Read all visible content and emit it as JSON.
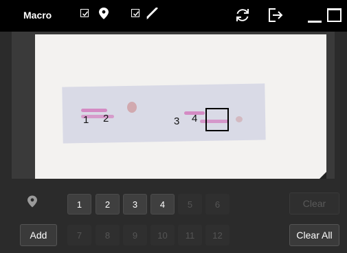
{
  "window": {
    "title": "Macro"
  },
  "toolbar": {
    "show_markers_checked": true,
    "show_annotations_checked": true,
    "icons": [
      "checkbox",
      "location-pin-icon",
      "checkbox",
      "pen-icon",
      "refresh-icon",
      "export-icon",
      "minimize-icon",
      "maximize-icon"
    ]
  },
  "slide_labels": [
    "1",
    "2",
    "3",
    "4"
  ],
  "positions": {
    "row1": [
      {
        "label": "1",
        "active": true
      },
      {
        "label": "2",
        "active": true
      },
      {
        "label": "3",
        "active": true
      },
      {
        "label": "4",
        "active": true
      },
      {
        "label": "5",
        "active": false
      },
      {
        "label": "6",
        "active": false
      }
    ],
    "row2": [
      {
        "label": "7",
        "active": false
      },
      {
        "label": "8",
        "active": false
      },
      {
        "label": "9",
        "active": false
      },
      {
        "label": "10",
        "active": false
      },
      {
        "label": "11",
        "active": false
      },
      {
        "label": "12",
        "active": false
      }
    ]
  },
  "actions": {
    "add_label": "Add",
    "clear_label": "Clear",
    "clear_all_label": "Clear All"
  },
  "colors": {
    "titlebar": "#000000",
    "background": "#2b2b2b",
    "tissue_stain": "#d48bc4"
  }
}
